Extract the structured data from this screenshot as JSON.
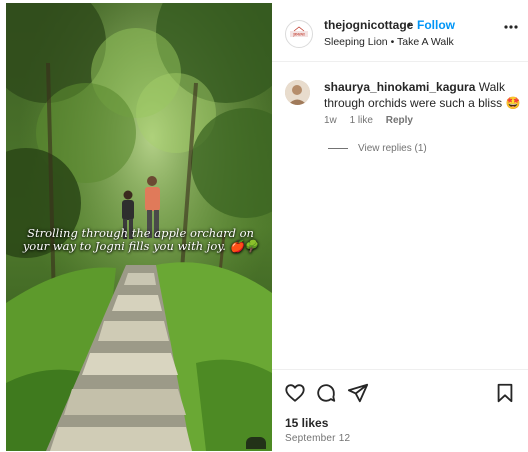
{
  "post": {
    "caption_overlay": "Strolling through the apple orchard on your way to Jogni fills you with joy. 🍎🌳",
    "logo_text": "THE JOGNI COTTAGE"
  },
  "header": {
    "username": "thejognicottage",
    "separator": "•",
    "follow_label": "Follow",
    "audio": "Sleeping Lion",
    "sub_separator": "•",
    "location": "Take A Walk",
    "more_icon": "more-horizontal-icon"
  },
  "comment": {
    "username": "shaurya_hinokami_kagura",
    "text": "Walk through orchids were such a bliss",
    "emoji": "🤩",
    "time": "1w",
    "likes": "1 like",
    "reply_label": "Reply",
    "view_replies": "View replies (1)"
  },
  "actions": {
    "icons": [
      "heart-icon",
      "comment-icon",
      "share-icon",
      "bookmark-icon"
    ],
    "likes": "15 likes",
    "date": "September 12"
  },
  "colors": {
    "follow": "#0095f6",
    "text": "#262626",
    "muted": "#737373",
    "border": "#efefef"
  }
}
